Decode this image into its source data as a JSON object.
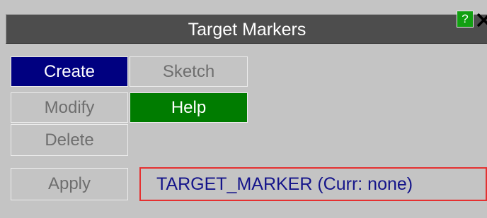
{
  "window": {
    "title": "Target Markers",
    "help_label": "?",
    "close_icon": "close-icon"
  },
  "buttons": {
    "create": "Create",
    "sketch": "Sketch",
    "modify": "Modify",
    "help": "Help",
    "delete": "Delete",
    "apply": "Apply"
  },
  "target_field": {
    "text": "TARGET_MARKER (Curr: none)"
  },
  "colors": {
    "panel_bg": "#c4c4c4",
    "titlebar_bg": "#4d4d4d",
    "active_bg": "#000080",
    "help_bg": "#007c00",
    "field_border": "#e53030",
    "field_text": "#14148a"
  }
}
